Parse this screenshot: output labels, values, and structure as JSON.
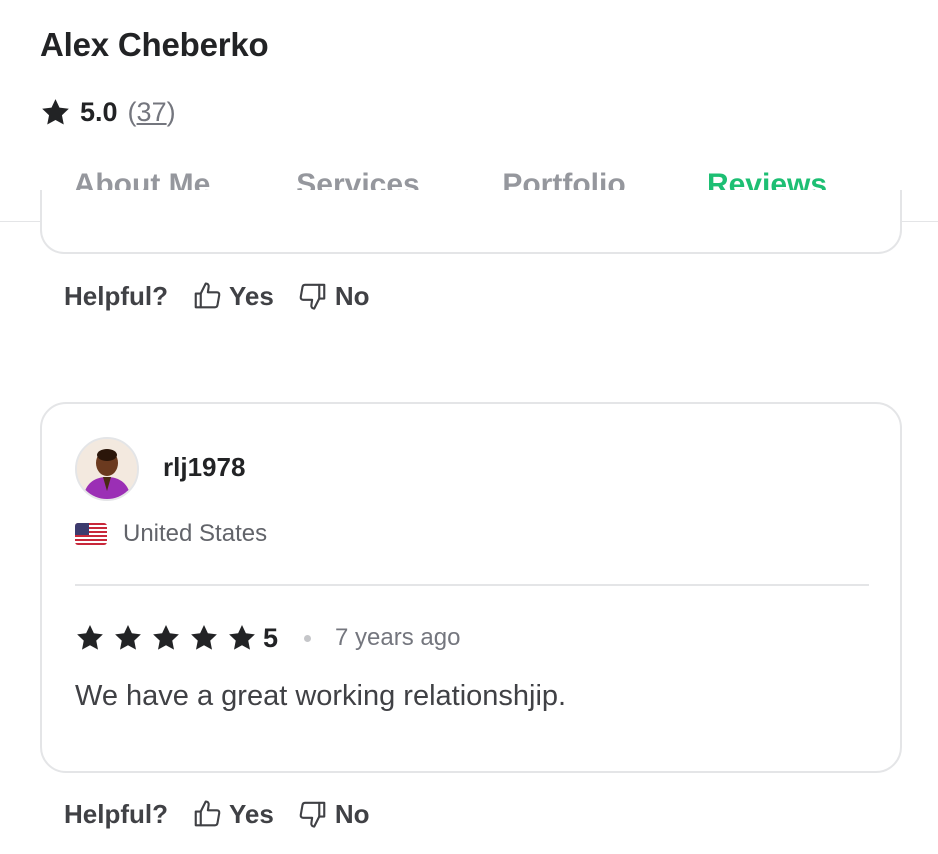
{
  "seller": {
    "name": "Alex Cheberko",
    "rating": "5.0",
    "review_count": "(37)",
    "review_count_number": "37"
  },
  "tabs": [
    {
      "label": "About Me",
      "active": false
    },
    {
      "label": "Services",
      "active": false
    },
    {
      "label": "Portfolio",
      "active": false
    },
    {
      "label": "Reviews",
      "active": true
    }
  ],
  "helpful": {
    "label": "Helpful?",
    "yes_label": "Yes",
    "no_label": "No"
  },
  "review": {
    "reviewer": "rlj1978",
    "country": "United States",
    "score": "5",
    "stars": 5,
    "time": "7 years ago",
    "text": "We have a great working relationshjip."
  },
  "colors": {
    "accent": "#1dbf73",
    "text_dark": "#222325",
    "text_muted": "#95979d",
    "border": "#e4e5e7"
  },
  "icons": {
    "rating": "star-icon",
    "yes": "thumbs-up-icon",
    "no": "thumbs-down-icon",
    "flag": "us-flag-icon"
  }
}
